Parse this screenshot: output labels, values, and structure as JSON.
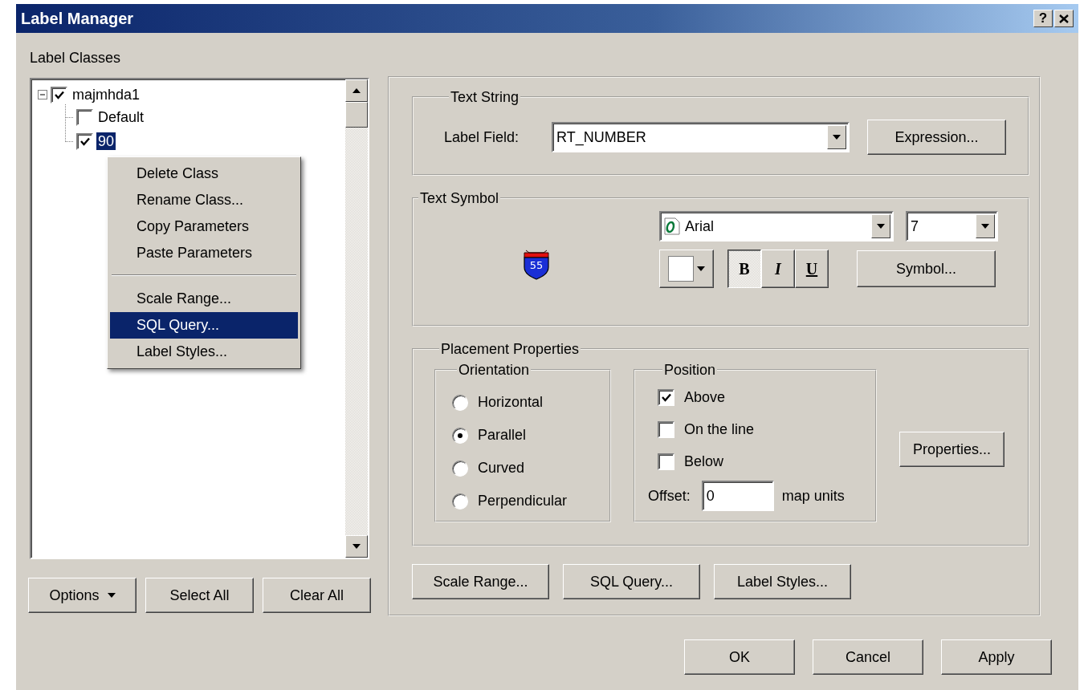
{
  "window": {
    "title": "Label Manager",
    "help_button": "?"
  },
  "label_classes": {
    "heading": "Label Classes",
    "tree": [
      {
        "label": "majmhda1",
        "checked": true,
        "expanded": true,
        "selected": false,
        "children": [
          {
            "label": "Default",
            "checked": false,
            "selected": false
          },
          {
            "label": "90",
            "checked": true,
            "selected": true
          }
        ]
      }
    ],
    "buttons": [
      {
        "label": "Options",
        "kind": "menu"
      },
      {
        "label": "Select All",
        "kind": "plain"
      },
      {
        "label": "Clear All",
        "kind": "plain"
      }
    ]
  },
  "context_menu": {
    "items": [
      {
        "kind": "item",
        "label": "Delete Class",
        "selected": false
      },
      {
        "kind": "item",
        "label": "Rename Class...",
        "selected": false
      },
      {
        "kind": "item",
        "label": "Copy Parameters",
        "selected": false
      },
      {
        "kind": "item",
        "label": "Paste Parameters",
        "selected": false
      },
      {
        "kind": "separator"
      },
      {
        "kind": "item",
        "label": "Scale Range...",
        "selected": false
      },
      {
        "kind": "item",
        "label": "SQL Query...",
        "selected": true
      },
      {
        "kind": "item",
        "label": "Label Styles...",
        "selected": false
      }
    ]
  },
  "text_string": {
    "title": "Text String",
    "label": "Label Field:",
    "value": "RT_NUMBER",
    "button": "Expression..."
  },
  "text_symbol": {
    "title": "Text Symbol",
    "preview": "55",
    "font": "Arial",
    "size": "7",
    "style_buttons": [
      {
        "kind": "bold",
        "label": "B",
        "on": true
      },
      {
        "kind": "italic",
        "label": "I",
        "on": false
      },
      {
        "kind": "underline",
        "label": "U",
        "on": false
      }
    ],
    "button": "Symbol..."
  },
  "placement": {
    "title": "Placement Properties",
    "orientation": {
      "title": "Orientation",
      "options": [
        {
          "label": "Horizontal",
          "selected": false
        },
        {
          "label": "Parallel",
          "selected": true
        },
        {
          "label": "Curved",
          "selected": false
        },
        {
          "label": "Perpendicular",
          "selected": false
        }
      ]
    },
    "position": {
      "title": "Position",
      "options": [
        {
          "label": "Above",
          "checked": true
        },
        {
          "label": "On the line",
          "checked": false
        },
        {
          "label": "Below",
          "checked": false
        }
      ],
      "offset_label": "Offset:",
      "offset_value": "0",
      "units": "map units"
    },
    "button": "Properties..."
  },
  "class_buttons": [
    "Scale Range...",
    "SQL Query...",
    "Label Styles..."
  ],
  "dialog_buttons": [
    "OK",
    "Cancel",
    "Apply"
  ]
}
